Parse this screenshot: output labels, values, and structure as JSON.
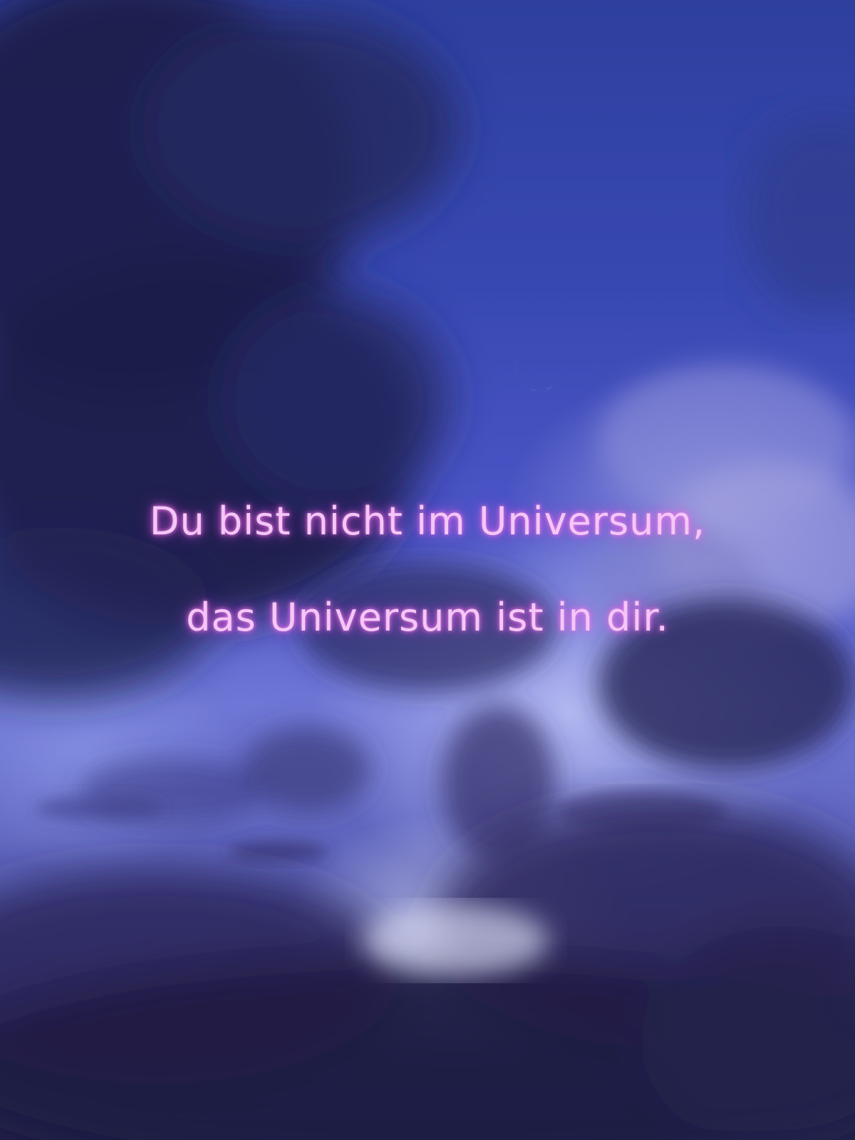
{
  "quote": {
    "line1": "Du bist nicht im Universum,",
    "line2": "das Universum ist in dir."
  },
  "colors": {
    "sky_top": "#2e3f9e",
    "sky_mid": "#4b55c6",
    "cloud_dark": "#1f1d44",
    "neon_text": "#f2c8f6",
    "neon_glow": "#e65ae6",
    "moon": "#ffffff"
  },
  "icons": [
    "crescent-moon-icon"
  ]
}
